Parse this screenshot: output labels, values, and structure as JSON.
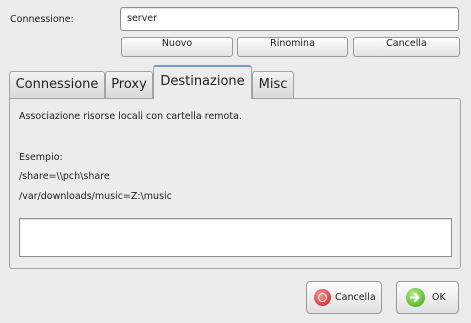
{
  "connection": {
    "label": "Connessione:",
    "value": "server",
    "buttons": {
      "new": "Nuovo",
      "rename": "Rinomina",
      "delete": "Cancella"
    }
  },
  "tabs": [
    {
      "label": "Connessione",
      "active": false
    },
    {
      "label": "Proxy",
      "active": false
    },
    {
      "label": "Destinazione",
      "active": true
    },
    {
      "label": "Misc",
      "active": false
    }
  ],
  "destination": {
    "description": "Associazione risorse locali con cartella remota.",
    "example_title": "Esempio:",
    "example_1": "/share=\\\\pch\\share",
    "example_2": "/var/downloads/music=Z:\\music",
    "mapping_value": ""
  },
  "footer": {
    "cancel_label": "Cancella",
    "ok_label": "OK"
  },
  "icons": {
    "cancel": "cancel-icon",
    "ok": "ok-arrow-icon"
  },
  "colors": {
    "tab_accent": "#6f9bd1",
    "cancel_icon": "#d93a3a",
    "ok_icon": "#5cb82f"
  }
}
